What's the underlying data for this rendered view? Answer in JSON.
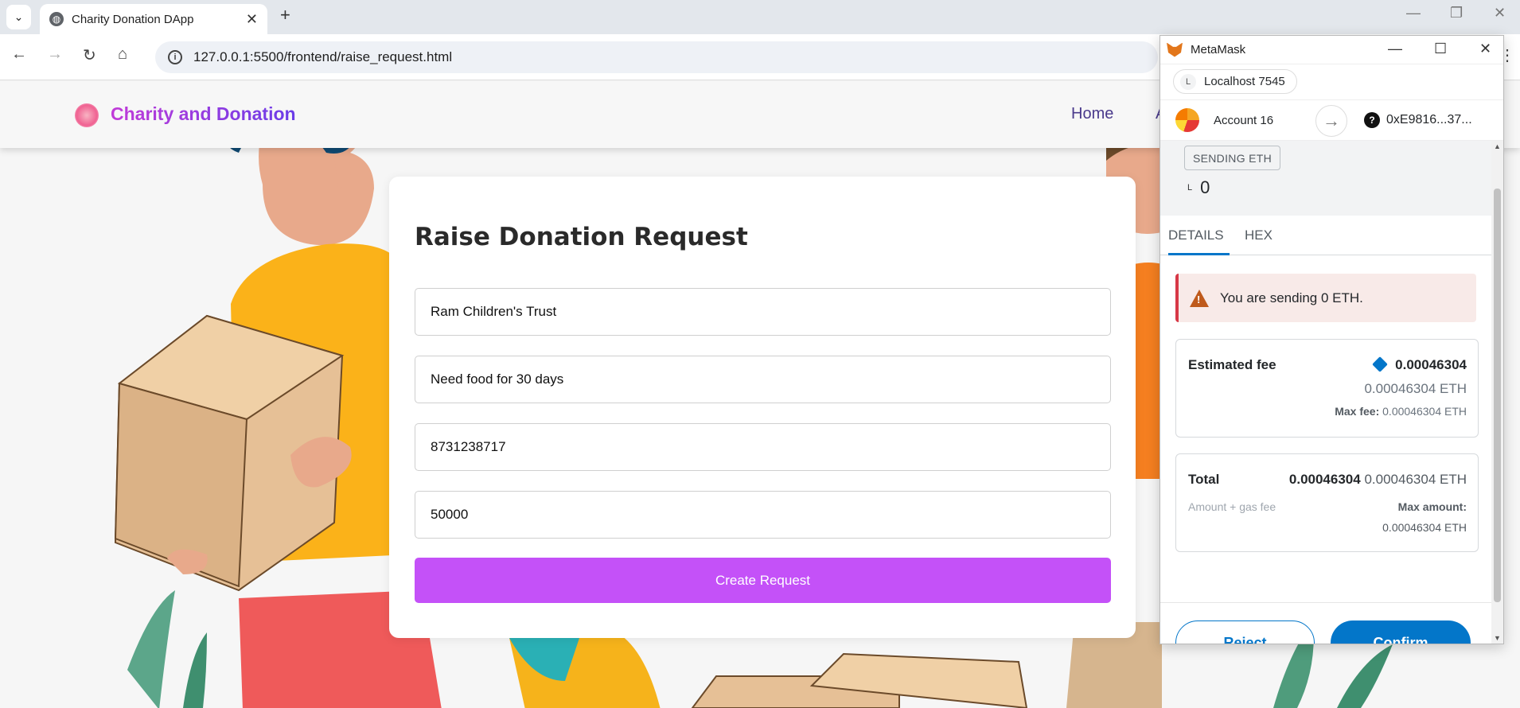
{
  "browser": {
    "tab_title": "Charity Donation DApp",
    "url": "127.0.0.1:5500/frontend/raise_request.html"
  },
  "site": {
    "brand": "Charity and Donation",
    "nav": {
      "home": "Home",
      "partial": "A"
    }
  },
  "form": {
    "heading": "Raise Donation Request",
    "fields": [
      {
        "value": "Ram Children's Trust"
      },
      {
        "value": "Need food for 30 days"
      },
      {
        "value": "8731238717"
      },
      {
        "value": "50000"
      }
    ],
    "submit_label": "Create Request"
  },
  "metamask": {
    "window_title": "MetaMask",
    "network_initial": "L",
    "network": "Localhost 7545",
    "account": "Account 16",
    "recipient": "0xE9816...37...",
    "action_badge": "SENDING ETH",
    "amount_initial": "L",
    "amount": "0",
    "tabs": [
      "DETAILS",
      "HEX"
    ],
    "warning": "You are sending 0 ETH.",
    "estimated_fee": {
      "label": "Estimated fee",
      "primary": "0.00046304",
      "secondary": "0.00046304 ETH",
      "max_fee_label": "Max fee:",
      "max_fee": "0.00046304 ETH"
    },
    "total": {
      "label": "Total",
      "primary": "0.00046304",
      "secondary": "0.00046304 ETH",
      "sub": "Amount + gas fee",
      "max_amount_label": "Max amount:",
      "max_amount": "0.00046304 ETH"
    },
    "reject_label": "Reject",
    "confirm_label": "Confirm"
  },
  "colors": {
    "submit": "#c451f8",
    "metamask_primary": "#0376c9",
    "warning_bg": "#f8eae8"
  }
}
